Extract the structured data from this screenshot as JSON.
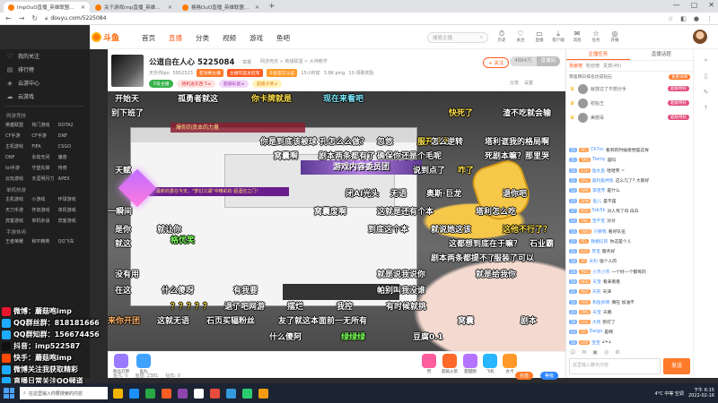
{
  "browser": {
    "tabs": [
      {
        "title": "impOuO直播_英雄联盟直播_斗..."
      },
      {
        "title": "关于游戏imp直播_英雄联盟直..."
      },
      {
        "title": "格格OuO直播_英雄联盟直播_斗..."
      }
    ],
    "url": "douyu.com/5225084"
  },
  "header": {
    "logo": "斗鱼",
    "nav": [
      "首页",
      "直播",
      "分类",
      "视频",
      "游戏",
      "鱼吧"
    ],
    "nav_active": "直播",
    "search_placeholder": "搜索主播",
    "icons": [
      {
        "label": "历史",
        "icon": "history-icon",
        "glyph": "⏱"
      },
      {
        "label": "关注",
        "icon": "heart-icon",
        "glyph": "♡"
      },
      {
        "label": "直播",
        "icon": "live-icon",
        "glyph": "▭"
      },
      {
        "label": "客户端",
        "icon": "download-icon",
        "glyph": "⤓"
      },
      {
        "label": "消息",
        "icon": "message-icon",
        "glyph": "✉"
      },
      {
        "label": "任务",
        "icon": "task-icon",
        "glyph": "☆"
      },
      {
        "label": "开播",
        "icon": "broadcast-icon",
        "glyph": "◎"
      }
    ]
  },
  "sidebar": {
    "items": [
      {
        "label": "我的关注",
        "icon": "heart-icon",
        "glyph": "♡"
      },
      {
        "label": "排行榜",
        "icon": "rank-icon",
        "glyph": "▤"
      },
      {
        "label": "云游中心",
        "icon": "game-icon",
        "glyph": "◈"
      },
      {
        "label": "云游戏",
        "icon": "cloud-icon",
        "glyph": "☁"
      }
    ],
    "categories": [
      {
        "head": "网游竞技",
        "items": [
          "英雄联盟",
          "热门游戏",
          "DOTA2",
          "CF手游",
          "CF手游",
          "DNF",
          "主机游戏",
          "FIFA",
          "CSGO",
          "DNF",
          "永劫无间",
          "魔兽",
          "lol手游",
          "守望先锋",
          "传奇",
          "云玩游戏",
          "天涯明月刀",
          "APEX"
        ]
      },
      {
        "head": "单机热游",
        "items": [
          "主机游戏",
          "小游戏",
          "环球游戏",
          "天刀手游",
          "怀旧游戏",
          "单机游戏",
          "宾客游戏",
          "单机杂谈",
          "宾客游戏"
        ]
      },
      {
        "head": "手游休闲",
        "items": [
          "王者荣耀",
          "和平精英",
          "QQ飞车"
        ]
      }
    ]
  },
  "overlay": [
    {
      "text": "微博：蘑菇咆imp",
      "color": "#e6162d"
    },
    {
      "text": "QQ群丝群：818181666",
      "color": "#1eabff"
    },
    {
      "text": "QQ群知群：156674456",
      "color": "#1eabff"
    },
    {
      "text": "抖音：imp522587",
      "color": "#111111"
    },
    {
      "text": "快手：蘑菇咆imp",
      "color": "#ff4906"
    },
    {
      "text": "微博关注我获取精彩",
      "color": "#1eabff"
    },
    {
      "text": "直播日常关注QQ频道",
      "color": "#1eabff"
    }
  ],
  "room": {
    "title": "公道自在人心 5225084",
    "tag": "举报",
    "meta": "网游竞技 > 英雄联盟 > 大神教学",
    "report": "+ 关注",
    "follow": [
      "4884万",
      "直播间"
    ],
    "row2": [
      "天乐你ipo",
      "5952523",
      "亚洲男主播 ",
      "主播年度总冠军",
      "斗鱼官方认证",
      "15小时前",
      "3.8K ping",
      "10 领取奖励"
    ],
    "row3": [
      "5号主播",
      "随机送东西 5 ▸",
      "超级彩蛋 ▸",
      "超级大奖 ▸"
    ],
    "tools": [
      "分享",
      "设置"
    ]
  },
  "video": {
    "banner_gold": "游戏内容委员团",
    "banner_purple": "最新的勇在今天，\"梦幻江湖\"中精彩的 超酒空之门！",
    "banner_red": "爆你的资本的力量",
    "danmaku": [
      {
        "text": "开始天",
        "cls": ""
      },
      {
        "text": "孤勇者就这",
        "cls": ""
      },
      {
        "text": "你卡牌就是",
        "cls": "y"
      },
      {
        "text": "现在来看吧",
        "cls": "c"
      },
      {
        "text": "别下班了",
        "cls": ""
      },
      {
        "text": "快死了",
        "cls": "y"
      },
      {
        "text": "渣不吃就会输",
        "cls": ""
      },
      {
        "text": "你是到底该被球 孔怎么么做？",
        "cls": ""
      },
      {
        "text": "忽悠",
        "cls": ""
      },
      {
        "text": "服开就是",
        "cls": "y"
      },
      {
        "text": "怎么逆转",
        "cls": ""
      },
      {
        "text": "塔利诓我的格局啊",
        "cls": ""
      },
      {
        "text": "窝囊啊",
        "cls": ""
      },
      {
        "text": "剧本两条都有了",
        "cls": ""
      },
      {
        "text": "确保你还是个毛呢",
        "cls": ""
      },
      {
        "text": "死剧本嘛？那里哭",
        "cls": ""
      },
      {
        "text": "天赋",
        "cls": ""
      },
      {
        "text": "说到点了",
        "cls": ""
      },
      {
        "text": "咋了",
        "cls": "y"
      },
      {
        "text": "闭AI光头",
        "cls": ""
      },
      {
        "text": "无语",
        "cls": ""
      },
      {
        "text": "奥斯·巨龙",
        "cls": ""
      },
      {
        "text": "退你吧",
        "cls": ""
      },
      {
        "text": "一瞬间",
        "cls": ""
      },
      {
        "text": "窝囊废啊",
        "cls": ""
      },
      {
        "text": "这就是还有个本",
        "cls": ""
      },
      {
        "text": "塔利怎么吃",
        "cls": ""
      },
      {
        "text": "是你",
        "cls": ""
      },
      {
        "text": "就让你",
        "cls": ""
      },
      {
        "text": "到底这个本",
        "cls": ""
      },
      {
        "text": "就说她这该",
        "cls": ""
      },
      {
        "text": "这他不行了？",
        "cls": "y"
      },
      {
        "text": "就这",
        "cls": ""
      },
      {
        "text": "这都想到底在于嘛？",
        "cls": ""
      },
      {
        "text": "石业霸",
        "cls": ""
      },
      {
        "text": "格优笑",
        "cls": "g"
      },
      {
        "text": "剧本两条都提不了",
        "cls": ""
      },
      {
        "text": "服装了可以",
        "cls": ""
      },
      {
        "text": "没有用",
        "cls": ""
      },
      {
        "text": "就是说我说你",
        "cls": ""
      },
      {
        "text": "就是给我你",
        "cls": ""
      },
      {
        "text": "在这",
        "cls": ""
      },
      {
        "text": "什么傻呀",
        "cls": ""
      },
      {
        "text": "有我要",
        "cls": ""
      },
      {
        "text": "帕别叫我没谁",
        "cls": ""
      },
      {
        "text": "？？？？？",
        "cls": "y"
      },
      {
        "text": "退了吧网游",
        "cls": ""
      },
      {
        "text": "摆烂",
        "cls": ""
      },
      {
        "text": "我控",
        "cls": ""
      },
      {
        "text": "有时候就挑",
        "cls": ""
      },
      {
        "text": "来你开团",
        "cls": "o"
      },
      {
        "text": "这就无语",
        "cls": ""
      },
      {
        "text": "石页买辐粉丝",
        "cls": ""
      },
      {
        "text": "友了就这本面前一无所有",
        "cls": ""
      },
      {
        "text": "窝囊",
        "cls": ""
      },
      {
        "text": "剧本",
        "cls": ""
      },
      {
        "text": "什么傻阿",
        "cls": ""
      },
      {
        "text": "绿绿绿",
        "cls": "g"
      },
      {
        "text": "豆腐0.1",
        "cls": ""
      }
    ]
  },
  "gifts": {
    "left": [
      {
        "label": "粉丝灯牌",
        "color": "#9a7bff"
      },
      {
        "label": "鱼丸",
        "color": "#3fa2ff"
      }
    ],
    "right": [
      {
        "label": "赞",
        "color": "#ff5d9e"
      },
      {
        "label": "超级火箭",
        "color": "#ff6a2a"
      },
      {
        "label": "甜甜圈",
        "color": "#b574ff"
      },
      {
        "label": "飞机",
        "color": "#27b6ff"
      },
      {
        "label": "办卡",
        "color": "#ff9a2a"
      }
    ],
    "bottom": [
      "鱼丸: 0",
      "鱼翅: 2381",
      "钻石: 0"
    ],
    "recharge": "充值",
    "level": "等级"
  },
  "chat": {
    "tabs": [
      "主播任务",
      "直播话题"
    ],
    "active_tab": "主播任务",
    "subtabs": [
      "贡献榜",
      "粉丝榜",
      "贵宾(45)"
    ],
    "notice": "恭喜明日排名达成钻石",
    "notice_badge": "查看详情",
    "rank": [
      {
        "name": "就放过了不想分手",
        "pill": "超级特权"
      },
      {
        "name": "初始王",
        "pill": "超级特权"
      },
      {
        "name": "美丽哥",
        "pill": "超级特权"
      }
    ],
    "messages": [
      {
        "lv": "15",
        "fan": "ATL",
        "user": "Ch7cc",
        "text": "看到的时候感觉是这样"
      },
      {
        "lv": "31",
        "fan": "TWS",
        "user": "Tiemy",
        "text": "是吗"
      },
      {
        "lv": "20",
        "fan": "G2H",
        "user": "鱼丸鱼",
        "text": "哈哈笑 ~"
      },
      {
        "lv": "11",
        "fan": "ORS",
        "user": "奥利奥拌饭",
        "text": "这么几了? 大家好"
      },
      {
        "lv": "12",
        "fan": "KRM",
        "user": "李连芳",
        "text": "是什么"
      },
      {
        "lv": "25",
        "fan": "ORM",
        "user": "鱼儿",
        "text": "是不是"
      },
      {
        "lv": "17",
        "fan": "KOO",
        "user": "5dc5k",
        "text": "对人骂了吗 白白"
      },
      {
        "lv": "14",
        "fan": "5NG",
        "user": "宝不宝",
        "text": "对对"
      },
      {
        "lv": "13",
        "fan": "OWO",
        "user": "只要我",
        "text": "看好队伍"
      },
      {
        "lv": "27",
        "fan": "ATL",
        "user": "我相信的",
        "text": "你这是个人"
      },
      {
        "lv": "22",
        "fan": "EOS",
        "user": "苏宝",
        "text": "服务好"
      },
      {
        "lv": "18",
        "fan": "AP",
        "user": "天利",
        "text": "强个人的"
      },
      {
        "lv": "28",
        "fan": "MSO",
        "user": "小杰小杰",
        "text": "一个好一个都有的"
      },
      {
        "lv": "19",
        "fan": "NGD",
        "user": "天宝",
        "text": "看来看看"
      },
      {
        "lv": "21",
        "fan": "MSX",
        "user": "天凯",
        "text": "天津"
      },
      {
        "lv": "12",
        "fan": "RGO",
        "user": "和鱼抓啊",
        "text": "偶在 加油不"
      },
      {
        "lv": "24",
        "fan": "KMG",
        "user": "天宝",
        "text": "天鹏"
      },
      {
        "lv": "16",
        "fan": "EDG",
        "user": "大钱",
        "text": "别打了"
      },
      {
        "lv": "23",
        "fan": "SO",
        "user": "Dargo",
        "text": "是啊"
      },
      {
        "lv": "10",
        "fan": "EOP",
        "user": "宝宝",
        "text": "2+1"
      }
    ],
    "tools": [
      "☺",
      "✉",
      "▣",
      "◎",
      "⚙"
    ],
    "input_placeholder": "这里输入聊天内容",
    "send": "发送"
  },
  "taskbar": {
    "search_placeholder": "在这里输入你要搜索的内容",
    "icon_colors": [
      "#f2b400",
      "#1e90ff",
      "#28a745",
      "#ff5d23",
      "#8e44ad",
      "#ffffff",
      "#e74c3c",
      "#3498db",
      "#2ecc71",
      "#f39c12"
    ],
    "tray": "4°C 中等 空调",
    "time": "下午 6:15",
    "date": "2022-02-16"
  }
}
